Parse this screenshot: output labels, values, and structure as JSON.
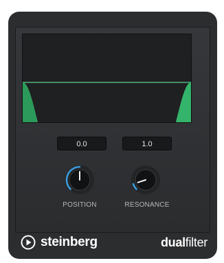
{
  "plugin": {
    "display": {
      "curve_color": "#3fae6b"
    },
    "controls": {
      "position": {
        "value": "0.0",
        "label": "POSITION",
        "level": 0.5
      },
      "resonance": {
        "value": "1.0",
        "label": "RESONANCE",
        "level": 0.1
      }
    },
    "footer": {
      "brand": "steinberg",
      "brand_icon": "steinberg-play-icon",
      "product_bold": "dual",
      "product_light": "filter"
    },
    "colors": {
      "accent_blue": "#3a9ee0",
      "filter_green": "#3fae6b",
      "panel": "#2c2d2f"
    }
  }
}
